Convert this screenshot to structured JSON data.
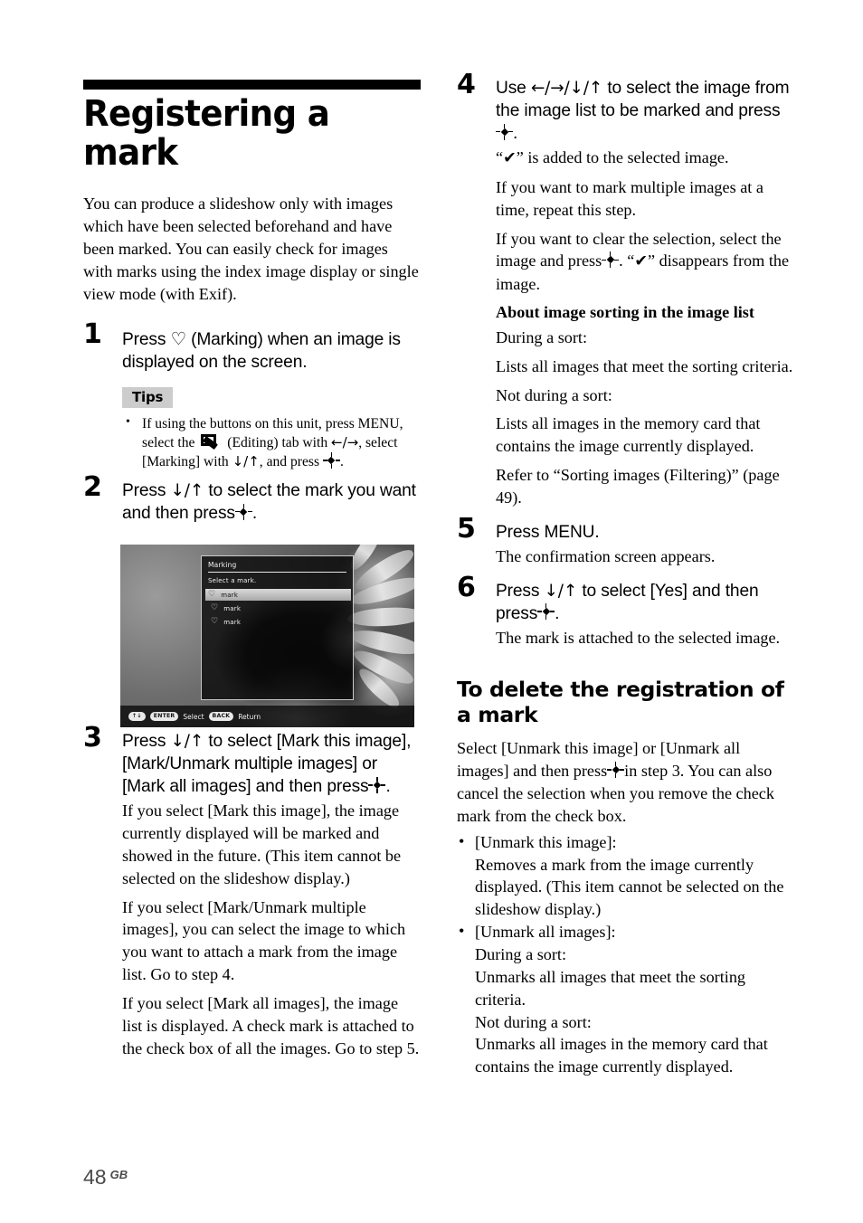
{
  "document": {
    "title": "Registering a mark",
    "intro": "You can produce a slideshow only with images which have been selected beforehand and have been marked. You can easily check for images with marks using the index image display or single view mode (with Exif).",
    "page_number": "48",
    "page_region_code": "GB"
  },
  "left_column": {
    "step1": {
      "number": "1",
      "head_before_icon": "Press",
      "icon": "heart-outline",
      "head_after_icon": "(Marking) when an image is displayed on the screen."
    },
    "tips": {
      "label": "Tips",
      "items": {
        "part1": "If using the buttons on this unit, press MENU, select the",
        "icon": "editing-tab-icon",
        "part2": "(Editing) tab with",
        "arrows_lr": "←/→",
        "part3": ", select [Marking] with",
        "arrows_du": "↓/↑",
        "part4": ", and press",
        "enter_symbol": "-♦-",
        "part5": "."
      }
    },
    "step2": {
      "number": "2",
      "head_part1": "Press",
      "arrows": "↓/↑",
      "head_part2": "to select the mark you want and then press",
      "enter_symbol": "-♦-",
      "head_part3": "."
    },
    "figure": {
      "name": "marking-screen-photo",
      "menu_title": "Marking",
      "menu_subtitle": "Select a mark.",
      "menu_items": [
        {
          "icon": "heart-icon",
          "label": "mark",
          "selected": true
        },
        {
          "icon": "heart-icon",
          "label": "mark",
          "selected": false
        },
        {
          "icon": "heart-icon",
          "label": "mark",
          "selected": false
        }
      ],
      "guide": {
        "dpad": "↑↓",
        "enter_key": "ENTER",
        "enter_action": "Select",
        "back_key": "BACK",
        "back_action": "Return"
      }
    },
    "step3": {
      "number": "3",
      "head_part1": "Press",
      "arrows": "↓/↑",
      "head_part2": "to select [Mark this image], [Mark/Unmark multiple images] or [Mark all images] and then press",
      "enter_symbol": "-♦-",
      "head_part3": ".",
      "body": [
        "If you select [Mark this image], the image currently displayed will be marked and showed in the future. (This item cannot be selected on the slideshow display.)",
        "If you select [Mark/Unmark multiple images], you can select the image to which you want to attach a mark from the image list. Go to step 4.",
        "If you select [Mark all images], the image list is displayed. A check mark is attached to the check box of all the images. Go to step 5."
      ]
    }
  },
  "right_column": {
    "step4": {
      "number": "4",
      "head_part1": "Use",
      "arrows": "←/→/↓/↑",
      "head_part2": "to select the image from the image list to be marked and press",
      "enter_symbol": "-♦-",
      "head_part3": ".",
      "body_line1_a": "“",
      "body_line1_check": "✔",
      "body_line1_b": "” is added to the selected image.",
      "body_line2": "If you want to mark multiple images at a time, repeat this step.",
      "body_line3_a": "If you want to clear the selection, select the image and press",
      "body_line3_enter": "-♦-",
      "body_line3_b": ". “",
      "body_line3_check": "✔",
      "body_line3_c": "” disappears from the image."
    },
    "sorting_note": {
      "heading": "About image sorting in the image list",
      "lines": [
        "During a sort:",
        "Lists all images that meet the sorting criteria.",
        "Not during a sort:",
        "Lists all images in the memory card that contains the image currently displayed.",
        "Refer to “Sorting images (Filtering)” (page 49)."
      ]
    },
    "step5": {
      "number": "5",
      "head": "Press MENU.",
      "body": "The confirmation screen appears."
    },
    "step6": {
      "number": "6",
      "head_part1": "Press",
      "arrows": "↓/↑",
      "head_part2": "to select [Yes] and then press",
      "enter_symbol": "-♦-",
      "head_part3": ".",
      "body": "The mark is attached to the selected image."
    },
    "delete_section": {
      "heading": "To delete the registration of a mark",
      "intro_a": "Select [Unmark this image] or [Unmark all images] and then press",
      "intro_enter": "-♦-",
      "intro_b": "in step 3. You can also cancel the selection when you remove the check mark from the check box.",
      "bullets": [
        {
          "title": "[Unmark this image]:",
          "lines": [
            "Removes a mark from the image currently displayed. (This item cannot be selected on the slideshow display.)"
          ]
        },
        {
          "title": "[Unmark all images]:",
          "lines": [
            "During a sort:",
            "Unmarks all images that meet the sorting criteria.",
            "Not during a sort:",
            "Unmarks all images in the memory card that contains the image currently displayed."
          ]
        }
      ]
    }
  }
}
